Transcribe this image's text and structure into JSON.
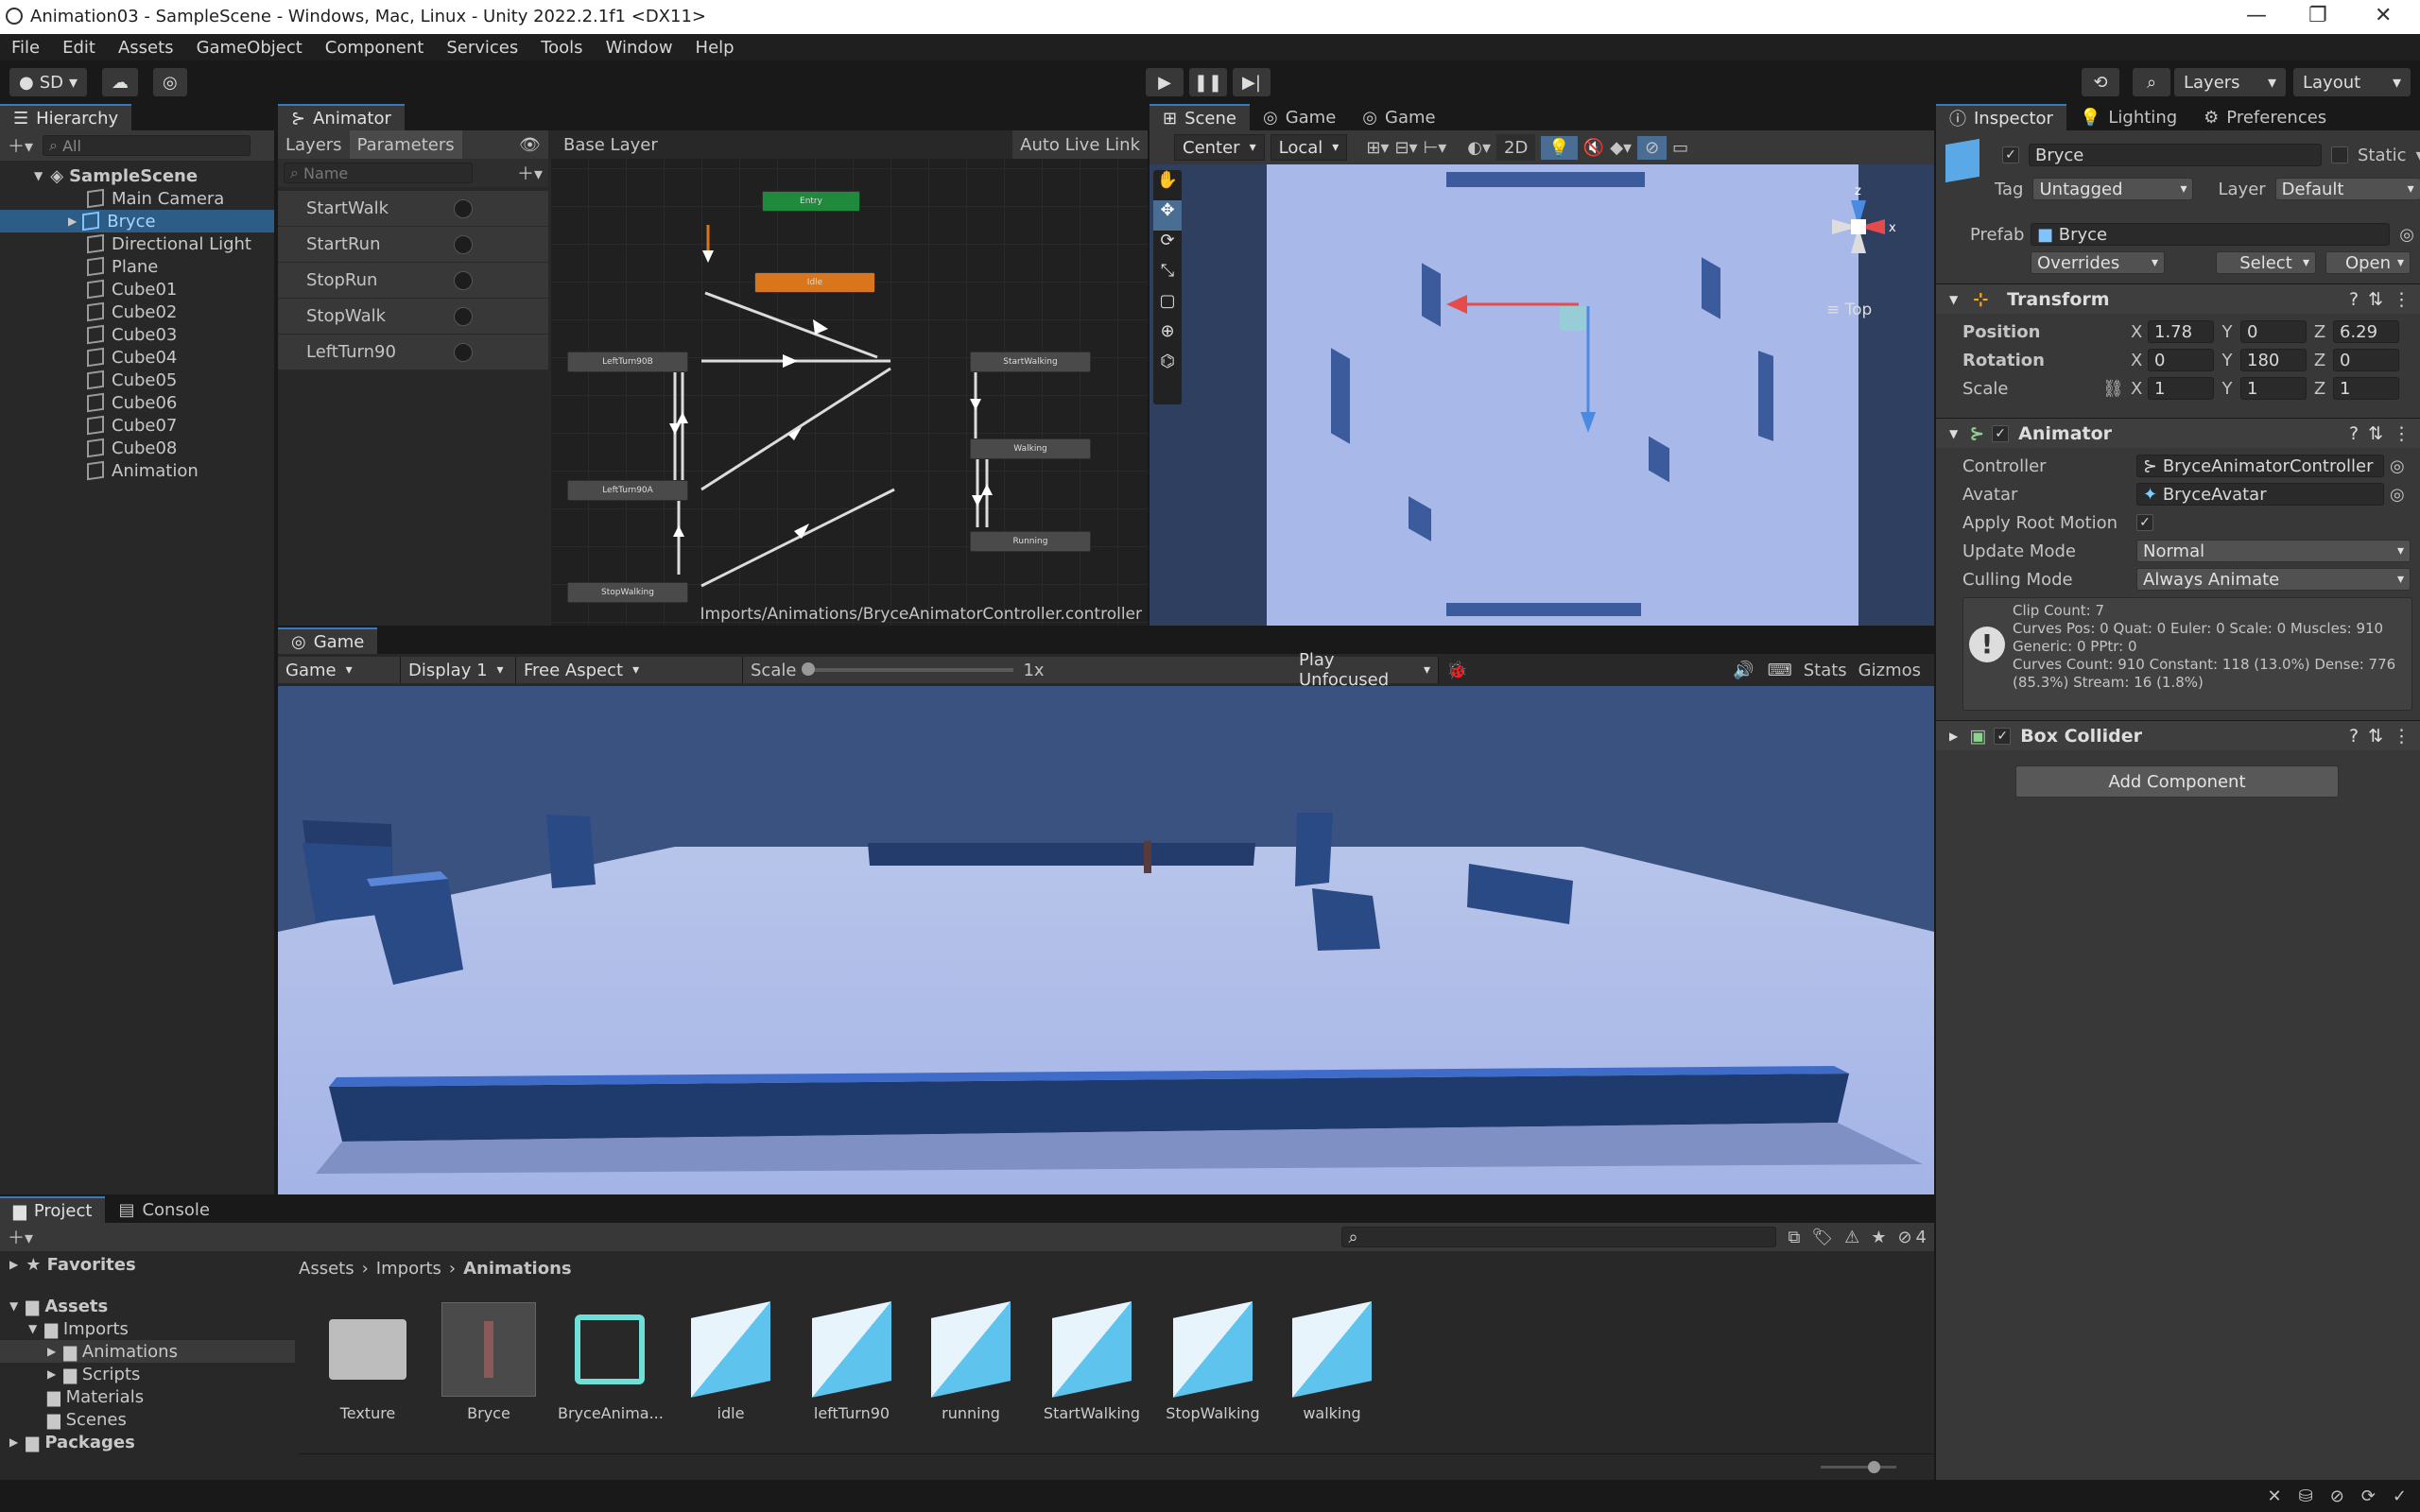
{
  "window": {
    "title": "Animation03 - SampleScene - Windows, Mac, Linux - Unity 2022.2.1f1 <DX11>"
  },
  "menu": [
    "File",
    "Edit",
    "Assets",
    "GameObject",
    "Component",
    "Services",
    "Tools",
    "Window",
    "Help"
  ],
  "toolbar": {
    "account": "SD",
    "layers": "Layers",
    "layout": "Layout"
  },
  "hierarchy": {
    "tab": "Hierarchy",
    "search_placeholder": "All",
    "scene": "SampleScene",
    "items": [
      "Main Camera",
      "Bryce",
      "Directional Light",
      "Plane",
      "Cube01",
      "Cube02",
      "Cube03",
      "Cube04",
      "Cube05",
      "Cube06",
      "Cube07",
      "Cube08",
      "Animation"
    ]
  },
  "animator": {
    "tab": "Animator",
    "layers_tab": "Layers",
    "params_tab": "Parameters",
    "name_placeholder": "Name",
    "base_layer": "Base Layer",
    "auto_live": "Auto Live Link",
    "params": [
      "StartWalk",
      "StartRun",
      "StopRun",
      "StopWalk",
      "LeftTurn90"
    ],
    "nodes": {
      "entry": "Entry",
      "idle": "Idle",
      "leftturn90": "LeftTurn90B",
      "startwalking": "StartWalking",
      "walking": "Walking",
      "leftturn90a": "LeftTurn90A",
      "running": "Running",
      "stopwalking": "StopWalking"
    },
    "path": "Imports/Animations/BryceAnimatorController.controller"
  },
  "scene": {
    "tabs": [
      "Scene",
      "Game",
      "Game"
    ],
    "pivot": "Center",
    "space": "Local",
    "mode2d": "2D",
    "view": "Top",
    "gizmo_x": "x",
    "gizmo_z": "z"
  },
  "game": {
    "tab": "Game",
    "display_mode": "Game",
    "display": "Display 1",
    "aspect": "Free Aspect",
    "scale_label": "Scale",
    "scale_value": "1x",
    "play_mode": "Play Unfocused",
    "stats": "Stats",
    "gizmos": "Gizmos"
  },
  "inspector": {
    "tabs": [
      "Inspector",
      "Lighting",
      "Preferences"
    ],
    "object_name": "Bryce",
    "static": "Static",
    "tag_label": "Tag",
    "tag": "Untagged",
    "layer_label": "Layer",
    "layer": "Default",
    "prefab_label": "Prefab",
    "prefab": "Bryce",
    "overrides": "Overrides",
    "select": "Select",
    "open": "Open",
    "transform": {
      "title": "Transform",
      "position_label": "Position",
      "pos": [
        "1.78",
        "0",
        "6.29"
      ],
      "rotation_label": "Rotation",
      "rot": [
        "0",
        "180",
        "0"
      ],
      "scale_label": "Scale",
      "scale": [
        "1",
        "1",
        "1"
      ]
    },
    "animator": {
      "title": "Animator",
      "controller_label": "Controller",
      "controller": "BryceAnimatorController",
      "avatar_label": "Avatar",
      "avatar": "BryceAvatar",
      "root_motion_label": "Apply Root Motion",
      "update_label": "Update Mode",
      "update": "Normal",
      "culling_label": "Culling Mode",
      "culling": "Always Animate",
      "info": [
        "Clip Count: 7",
        "Curves Pos: 0 Quat: 0 Euler: 0 Scale: 0 Muscles: 910",
        "Generic: 0 PPtr: 0",
        "Curves Count: 910 Constant: 118 (13.0%) Dense: 776",
        "(85.3%) Stream: 16 (1.8%)"
      ]
    },
    "box_collider": "Box Collider",
    "add_component": "Add Component"
  },
  "project": {
    "tabs": [
      "Project",
      "Console"
    ],
    "favorites": "Favorites",
    "assets": "Assets",
    "tree": [
      "Imports",
      "Animations",
      "Scripts",
      "Materials",
      "Scenes"
    ],
    "packages": "Packages",
    "breadcrumb": [
      "Assets",
      "Imports",
      "Animations"
    ],
    "hidden_count": "4",
    "items": [
      "Texture",
      "Bryce",
      "BryceAnima...",
      "idle",
      "leftTurn90",
      "running",
      "StartWalking",
      "StopWalking",
      "walking"
    ]
  },
  "colors": {
    "accent": "#3a79bb",
    "selection": "#2c5d87",
    "idle_node": "#d9751a",
    "entry_node": "#1f8a3c"
  }
}
